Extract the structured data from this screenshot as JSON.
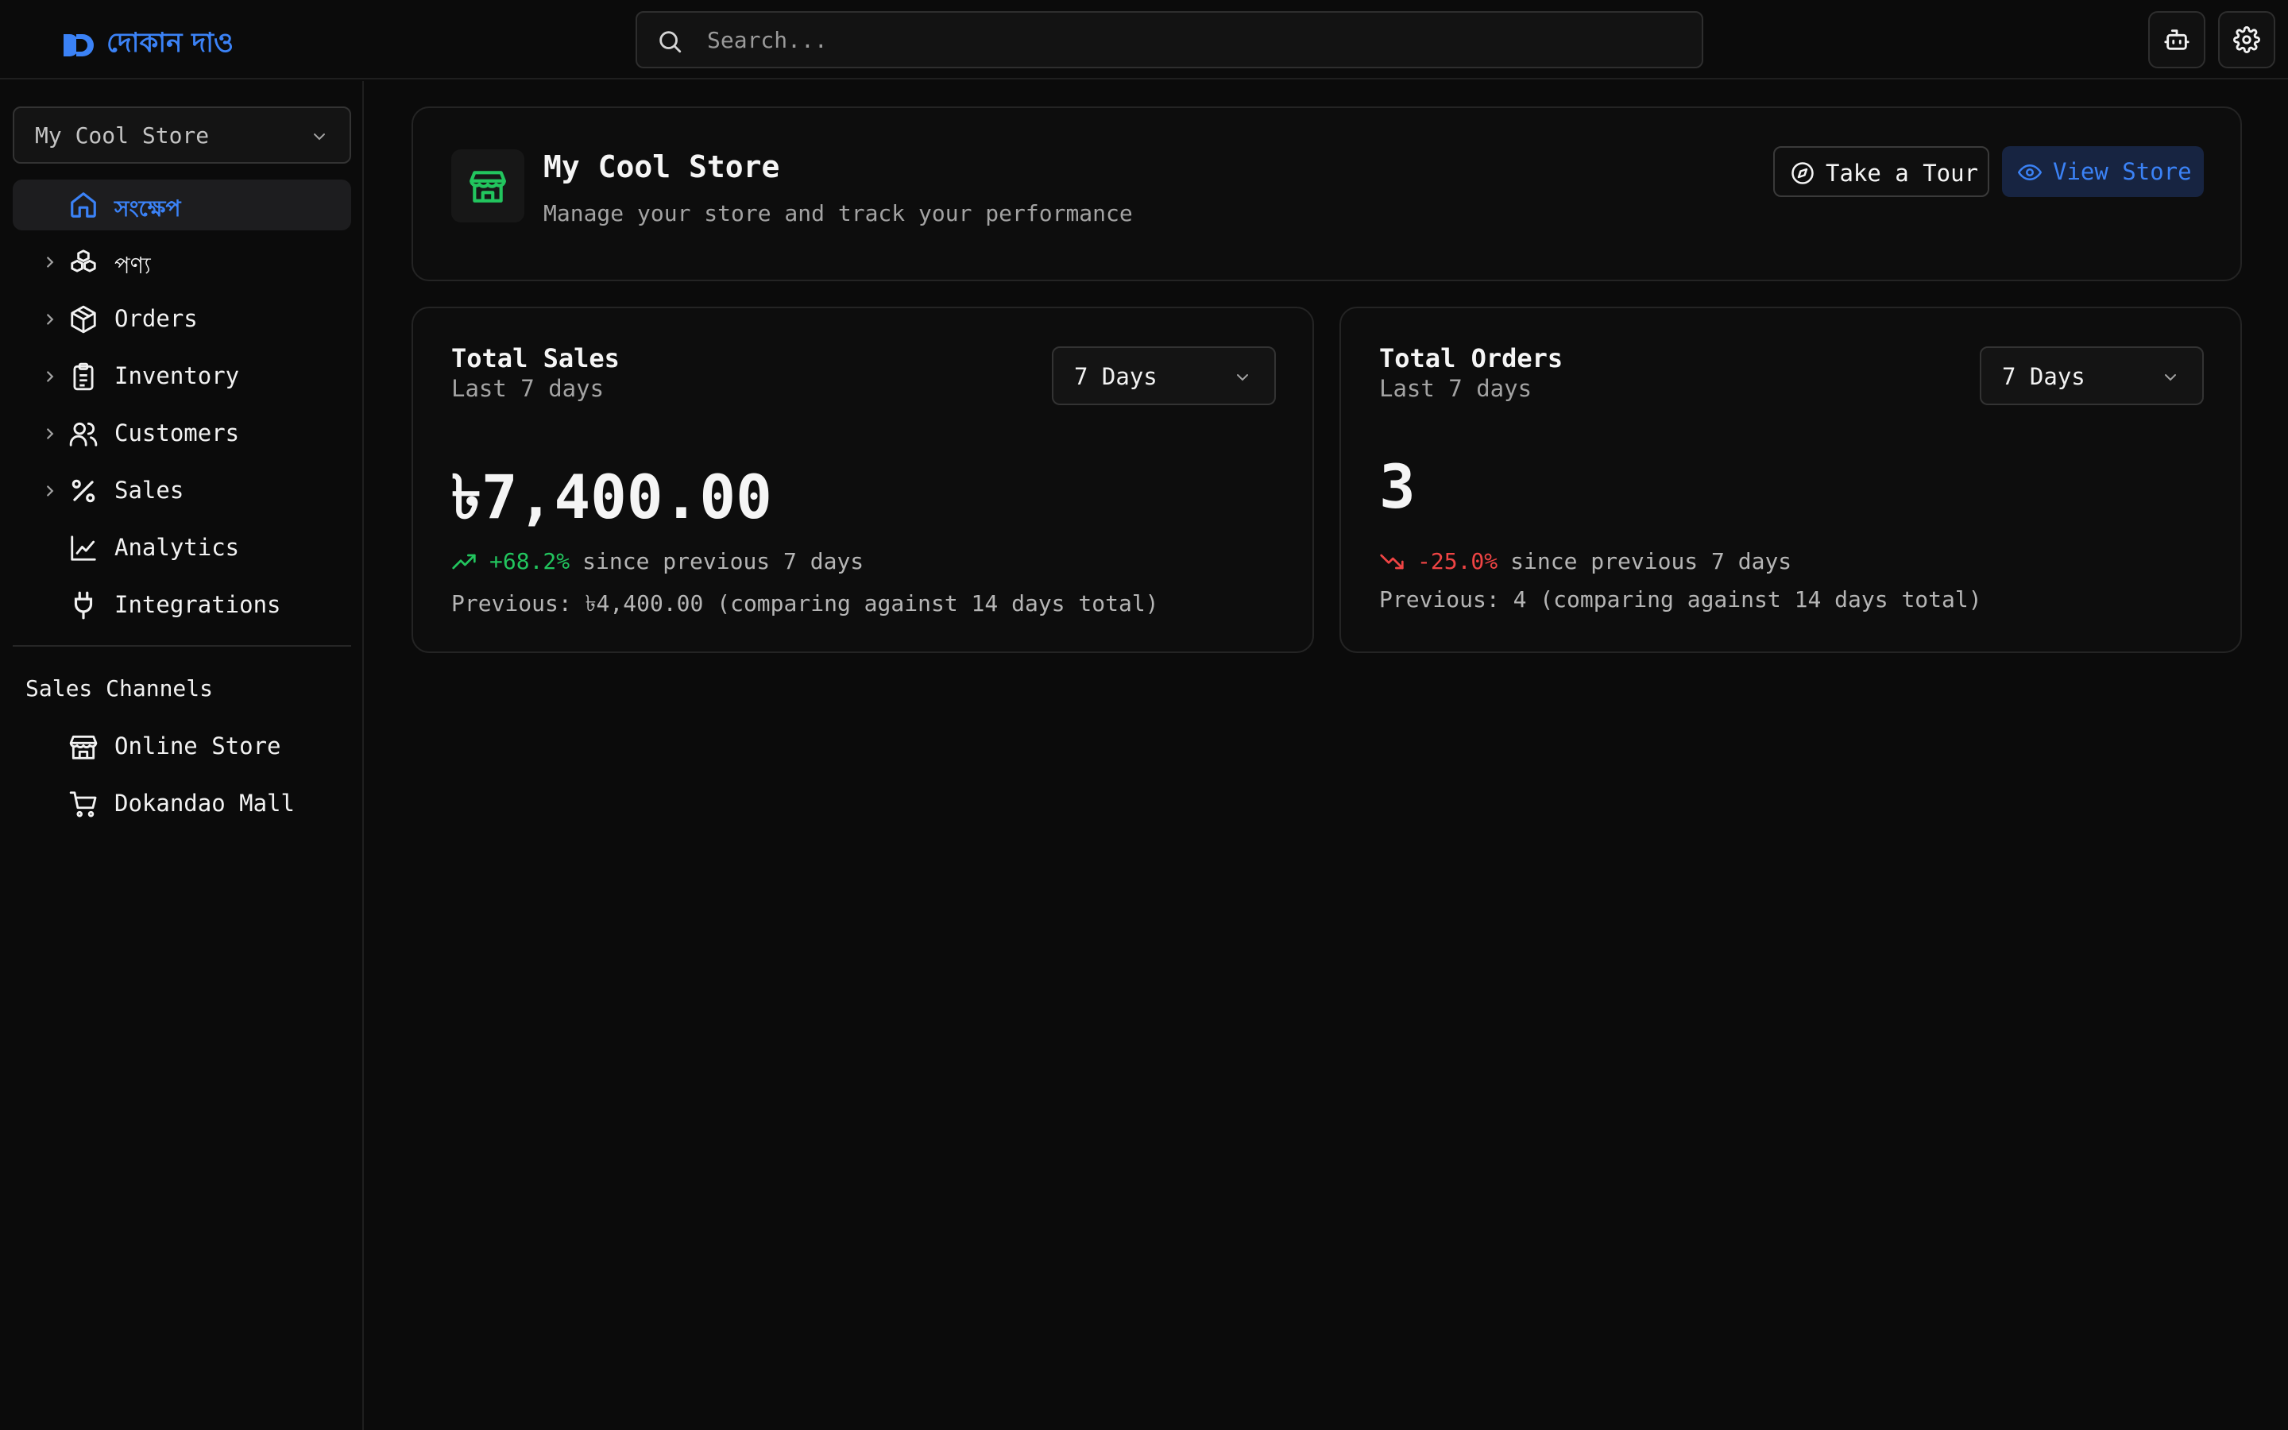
{
  "header": {
    "logo_text": "দোকান দাও",
    "search_placeholder": "Search...",
    "brand_color": "#3b82f6",
    "icons": [
      "search-icon",
      "bot-icon",
      "gear-icon"
    ]
  },
  "sidebar": {
    "store_selector": "My Cool Store",
    "items": [
      {
        "label": "সংক্ষেপ",
        "icon": "home-icon",
        "active": true,
        "expandable": false
      },
      {
        "label": "পণ্য",
        "icon": "boxes-icon",
        "active": false,
        "expandable": true
      },
      {
        "label": "Orders",
        "icon": "package-icon",
        "active": false,
        "expandable": true
      },
      {
        "label": "Inventory",
        "icon": "clipboard-icon",
        "active": false,
        "expandable": true
      },
      {
        "label": "Customers",
        "icon": "users-icon",
        "active": false,
        "expandable": true
      },
      {
        "label": "Sales",
        "icon": "percent-icon",
        "active": false,
        "expandable": true
      },
      {
        "label": "Analytics",
        "icon": "chart-line-icon",
        "active": false,
        "expandable": false
      },
      {
        "label": "Integrations",
        "icon": "plug-icon",
        "active": false,
        "expandable": false
      }
    ],
    "channels_title": "Sales Channels",
    "channels": [
      {
        "label": "Online Store",
        "icon": "store-icon"
      },
      {
        "label": "Dokandao Mall",
        "icon": "cart-icon"
      }
    ]
  },
  "store": {
    "name": "My Cool Store",
    "description": "Manage your store and track your performance",
    "tour_label": "Take a Tour",
    "view_label": "View Store",
    "accent_color": "#22c55e"
  },
  "stats": {
    "sales": {
      "title": "Total Sales",
      "subtitle": "Last 7 days",
      "period": "7 Days",
      "value": "৳7,400.00",
      "change": "+68.2%",
      "since": "since previous 7 days",
      "previous": "Previous: ৳4,400.00 (comparing against 14 days total)",
      "trend": "up"
    },
    "orders": {
      "title": "Total Orders",
      "subtitle": "Last 7 days",
      "period": "7 Days",
      "value": "3",
      "change": "-25.0%",
      "since": "since previous 7 days",
      "previous": "Previous: 4 (comparing against 14 days total)",
      "trend": "down"
    }
  }
}
